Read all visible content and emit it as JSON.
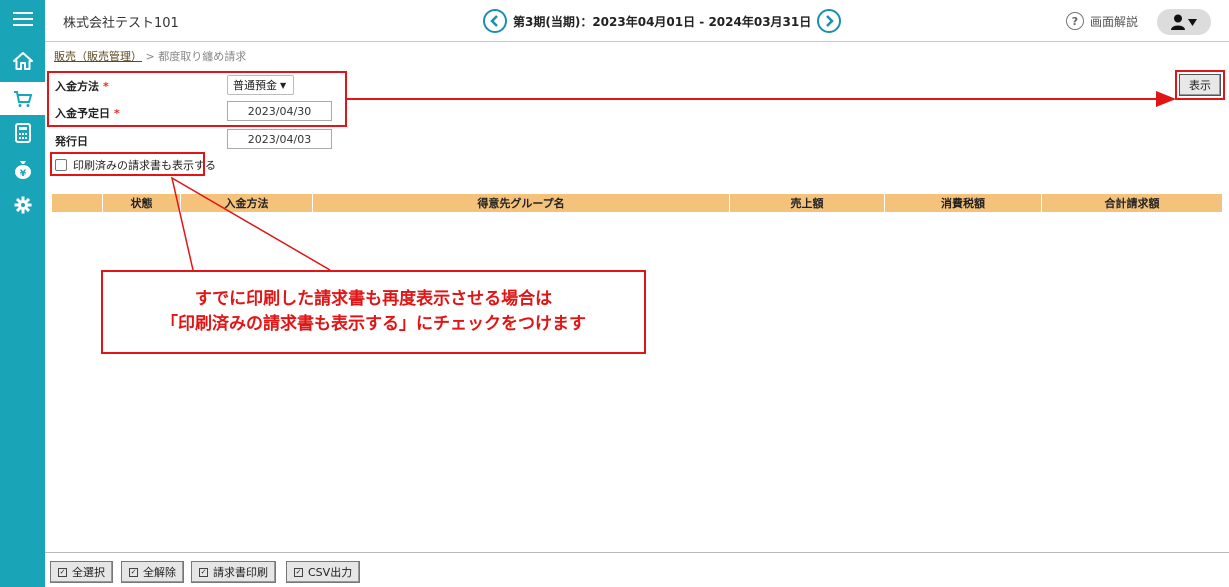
{
  "header": {
    "company": "株式会社テスト101",
    "period": "第3期(当期)：2023年04月01日 - 2024年03月31日",
    "help_label": "画面解説"
  },
  "breadcrumb": {
    "parent": "販売（販売管理）",
    "separator": ">",
    "current": "都度取り纏め請求"
  },
  "form": {
    "payment_method_label": "入金方法",
    "payment_method_value": "普通預金",
    "expected_date_label": "入金予定日",
    "expected_date_value": "2023/04/30",
    "issue_date_label": "発行日",
    "issue_date_value": "2023/04/03",
    "required_mark": "*",
    "show_printed_label": "印刷済みの請求書も表示する"
  },
  "show_button": "表示",
  "table": {
    "columns": [
      "",
      "状態",
      "入金方法",
      "得意先グループ名",
      "売上額",
      "消費税額",
      "合計請求額"
    ]
  },
  "callout": {
    "line1": "すでに印刷した請求書も再度表示させる場合は",
    "line2": "「印刷済みの請求書も表示する」にチェックをつけます"
  },
  "footer": {
    "select_all": "全選択",
    "deselect_all": "全解除",
    "print_invoice": "請求書印刷",
    "csv_output": "CSV出力"
  },
  "colors": {
    "sidebar": "#1aa4b8",
    "annotation": "#e01515",
    "table_header": "#f5c27c"
  }
}
